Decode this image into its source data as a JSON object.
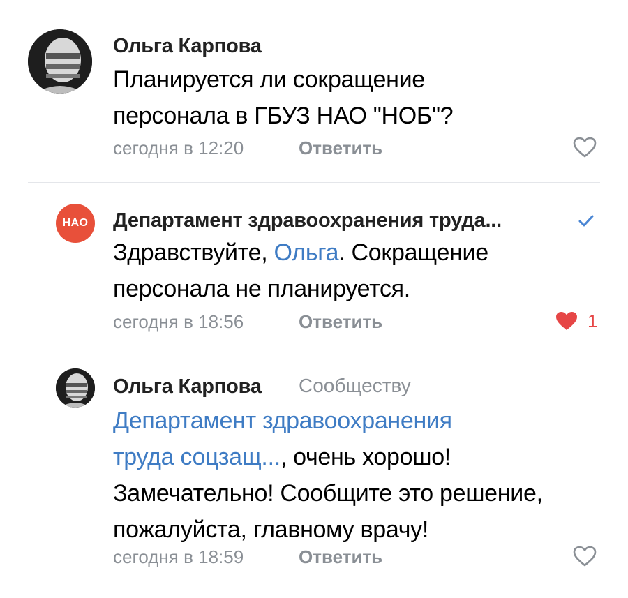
{
  "comments": [
    {
      "author": "Ольга Карпова",
      "lines": [
        "Планируется ли сокращение",
        "персонала в ГБУЗ НАО \"НОБ\"?"
      ],
      "time": "сегодня в 12:20",
      "reply_label": "Ответить",
      "liked": false
    },
    {
      "author": "Департамент здравоохранения труда...",
      "avatar_text": "НАО",
      "verified": true,
      "line1_pre": "Здравствуйте, ",
      "line1_link": "Ольга",
      "line1_post": ". Сокращение",
      "line2": "персонала не планируется.",
      "time": "сегодня в 18:56",
      "reply_label": "Ответить",
      "liked": true,
      "like_count": "1"
    },
    {
      "author": "Ольга Карпова",
      "to_label": "Сообществу",
      "link_line1": "Департамент здравоохранения",
      "link_line2": "труда соцзащ...",
      "line2_post": ", очень хорошо!",
      "line3": "Замечательно! Сообщите это решение,",
      "line4": "пожалуйста, главному врачу!",
      "time": "сегодня в 18:59",
      "reply_label": "Ответить",
      "liked": false
    }
  ],
  "colors": {
    "link": "#3f7cc4",
    "like": "#e64646",
    "meta": "#8a8f95",
    "verified": "#4a86d4",
    "org_avatar": "#e8503a"
  },
  "icons": [
    "heart-outline-icon",
    "heart-filled-icon",
    "verified-check-icon"
  ]
}
